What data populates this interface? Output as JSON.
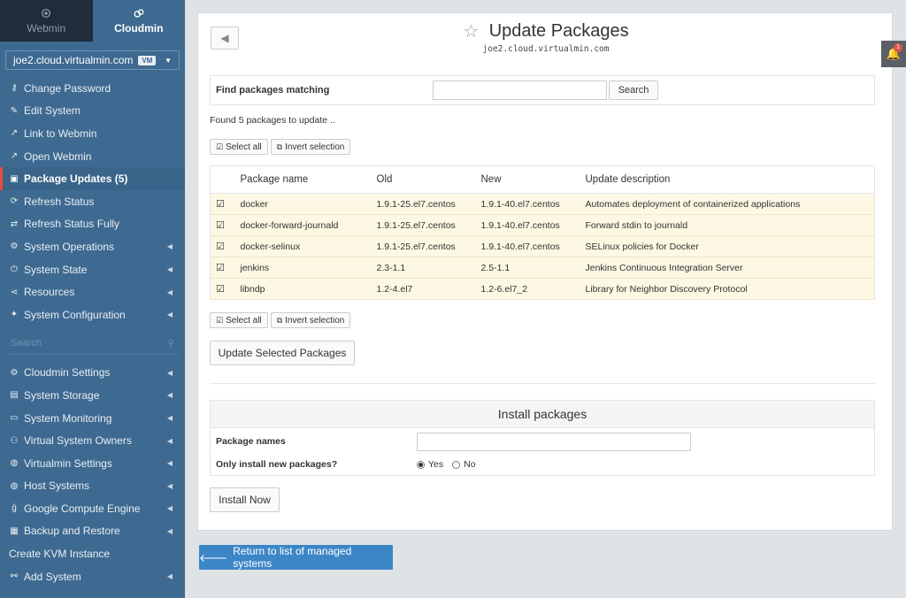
{
  "switcher": {
    "webmin": "Webmin",
    "cloudmin": "Cloudmin"
  },
  "host": {
    "name": "joe2.cloud.virtualmin.com",
    "badge": "VM"
  },
  "menu": [
    {
      "label": "Change Password",
      "icon": "key-icon"
    },
    {
      "label": "Edit System",
      "icon": "edit-icon"
    },
    {
      "label": "Link to Webmin",
      "icon": "external-link-icon"
    },
    {
      "label": "Open Webmin",
      "icon": "external-link-icon"
    },
    {
      "label": "Package Updates (5)",
      "icon": "package-icon",
      "active": true
    },
    {
      "label": "Refresh Status",
      "icon": "refresh-icon"
    },
    {
      "label": "Refresh Status Fully",
      "icon": "exchange-icon"
    },
    {
      "label": "System Operations",
      "icon": "gear-icon",
      "submenu": true
    },
    {
      "label": "System State",
      "icon": "power-icon",
      "submenu": true
    },
    {
      "label": "Resources",
      "icon": "share-icon",
      "submenu": true
    },
    {
      "label": "System Configuration",
      "icon": "wrench-icon",
      "submenu": true
    }
  ],
  "search_placeholder": "Search",
  "menu2": [
    {
      "label": "Cloudmin Settings",
      "icon": "gear-icon",
      "submenu": true
    },
    {
      "label": "System Storage",
      "icon": "storage-icon",
      "submenu": true
    },
    {
      "label": "System Monitoring",
      "icon": "monitor-icon",
      "submenu": true
    },
    {
      "label": "Virtual System Owners",
      "icon": "users-icon",
      "submenu": true
    },
    {
      "label": "Virtualmin Settings",
      "icon": "globe-icon",
      "submenu": true
    },
    {
      "label": "Host Systems",
      "icon": "globe-icon",
      "submenu": true
    },
    {
      "label": "Google Compute Engine",
      "icon": "google-icon",
      "submenu": true
    },
    {
      "label": "Backup and Restore",
      "icon": "save-icon",
      "submenu": true
    },
    {
      "label": "Create KVM Instance",
      "icon": "",
      "submenu": false
    },
    {
      "label": "Add System",
      "icon": "link-icon",
      "submenu": true
    }
  ],
  "page": {
    "title": "Update Packages",
    "subtitle": "joe2.cloud.virtualmin.com",
    "find_label": "Find packages matching",
    "search_button": "Search",
    "found_text": "Found 5 packages to update ..",
    "select_all": "Select all",
    "invert_selection": "Invert selection",
    "update_button": "Update Selected Packages",
    "columns": [
      "Package name",
      "Old",
      "New",
      "Update description"
    ],
    "packages": [
      {
        "name": "docker",
        "old": "1.9.1-25.el7.centos",
        "new": "1.9.1-40.el7.centos",
        "desc": "Automates deployment of containerized applications"
      },
      {
        "name": "docker-forward-journald",
        "old": "1.9.1-25.el7.centos",
        "new": "1.9.1-40.el7.centos",
        "desc": "Forward stdin to journald"
      },
      {
        "name": "docker-selinux",
        "old": "1.9.1-25.el7.centos",
        "new": "1.9.1-40.el7.centos",
        "desc": "SELinux policies for Docker"
      },
      {
        "name": "jenkins",
        "old": "2.3-1.1",
        "new": "2.5-1.1",
        "desc": "Jenkins Continuous Integration Server"
      },
      {
        "name": "libndp",
        "old": "1.2-4.el7",
        "new": "1.2-6.el7_2",
        "desc": "Library for Neighbor Discovery Protocol"
      }
    ],
    "install": {
      "heading": "Install packages",
      "names_label": "Package names",
      "only_new_label": "Only install new packages?",
      "yes": "Yes",
      "no": "No",
      "button": "Install Now"
    },
    "return_button": "Return to list of managed systems"
  },
  "notifications": {
    "count": "1"
  },
  "colors": {
    "sidebar": "#3e6a91",
    "active_marker": "#e74c3c",
    "primary_button": "#3c86c8",
    "row_highlight": "#fcf8e3"
  }
}
